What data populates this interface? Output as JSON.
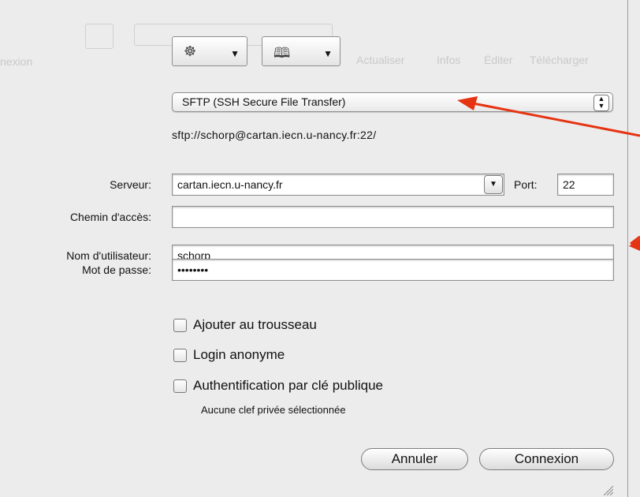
{
  "toolbar": {
    "server_popup_icon": "network-icon",
    "bookmarks_popup_icon": "book-icon"
  },
  "background": {
    "left_fragment": "nexion",
    "labels": [
      "Actualiser",
      "Infos",
      "Éditer",
      "Télécharger"
    ]
  },
  "protocol": {
    "selected": "SFTP (SSH Secure File Transfer)"
  },
  "url_preview": "sftp://schorp@cartan.iecn.u-nancy.fr:22/",
  "form": {
    "server_label": "Serveur:",
    "server_value": "cartan.iecn.u-nancy.fr",
    "port_label": "Port:",
    "port_value": "22",
    "path_label": "Chemin d'accès:",
    "path_value": "",
    "user_label": "Nom d'utilisateur:",
    "user_value": "schorp",
    "password_label": "Mot de passe:",
    "password_value": "••••••••"
  },
  "options": {
    "keychain_label": "Ajouter au trousseau",
    "anonymous_label": "Login anonyme",
    "pubkey_label": "Authentification par clé publique",
    "pubkey_note": "Aucune clef privée sélectionnée"
  },
  "buttons": {
    "cancel": "Annuler",
    "connect": "Connexion"
  },
  "colors": {
    "annotation_arrow": "#e63312"
  }
}
